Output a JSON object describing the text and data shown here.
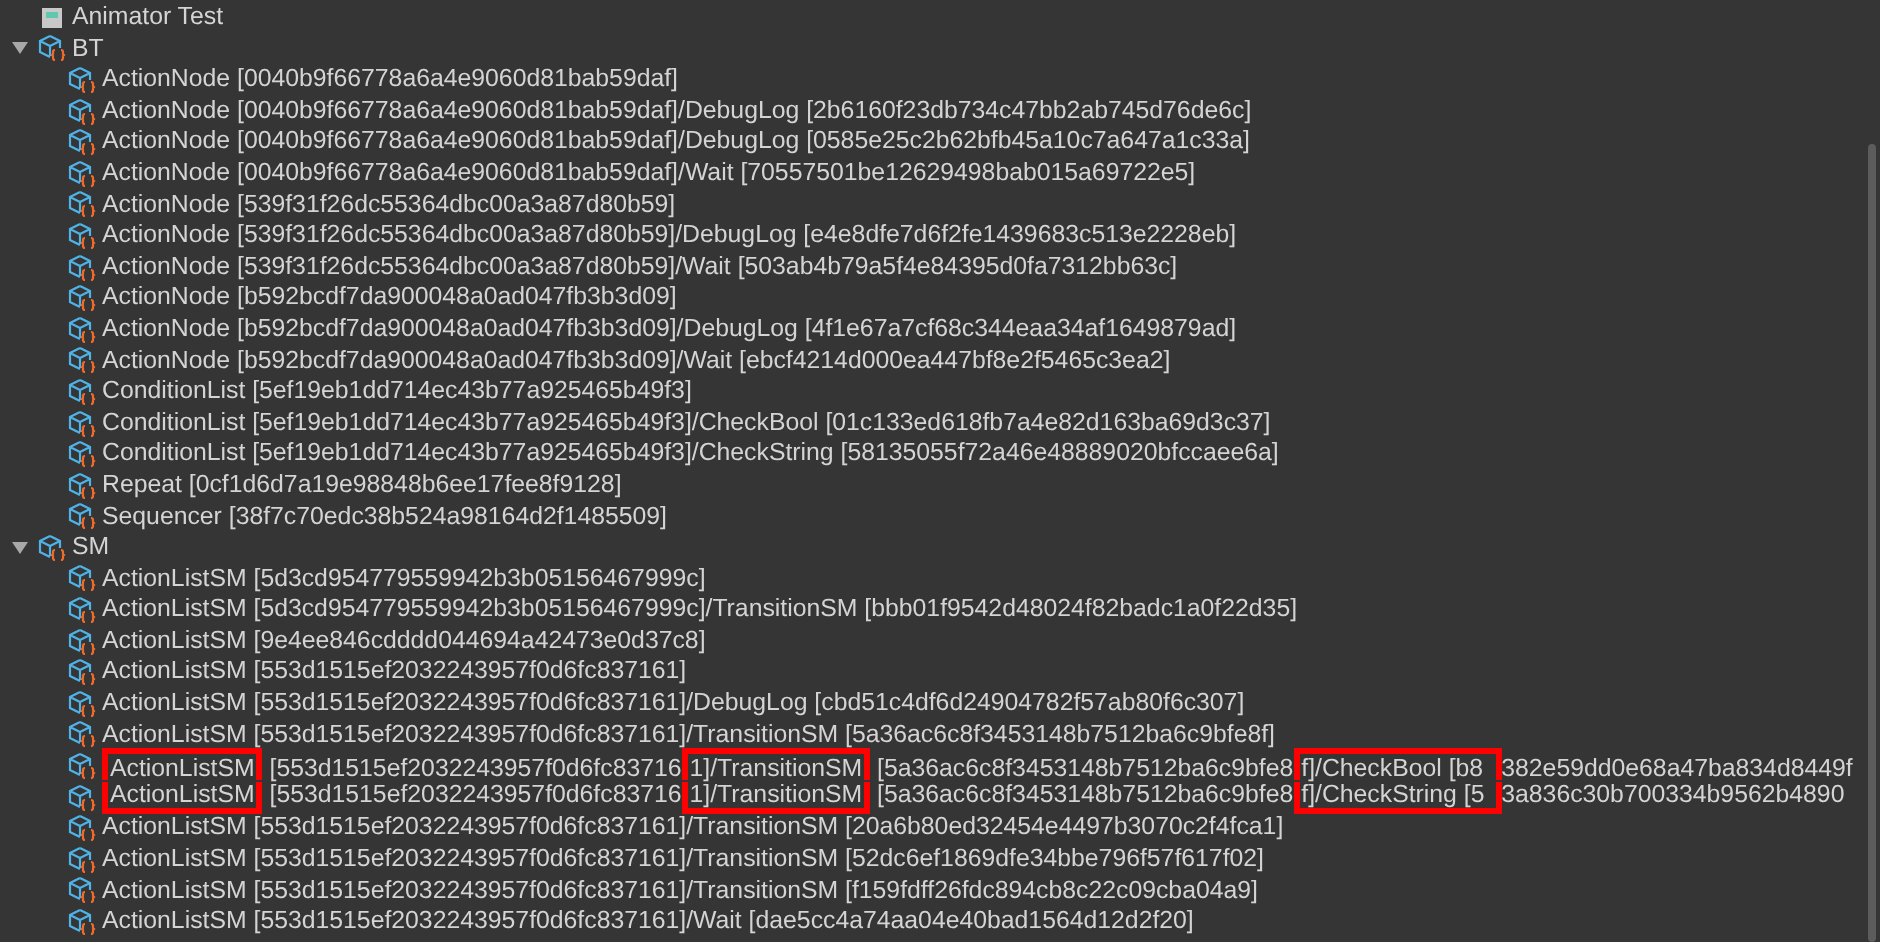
{
  "tree": [
    {
      "label": "Animator Test",
      "kind": "asset"
    },
    {
      "label": "BT",
      "kind": "group",
      "expanded": true,
      "children": [
        {
          "label": "ActionNode [0040b9f66778a6a4e9060d81bab59daf]",
          "kind": "node"
        },
        {
          "label": "ActionNode [0040b9f66778a6a4e9060d81bab59daf]/DebugLog [2b6160f23db734c47bb2ab745d76de6c]",
          "kind": "node"
        },
        {
          "label": "ActionNode [0040b9f66778a6a4e9060d81bab59daf]/DebugLog [0585e25c2b62bfb45a10c7a647a1c33a]",
          "kind": "node"
        },
        {
          "label": "ActionNode [0040b9f66778a6a4e9060d81bab59daf]/Wait [70557501be12629498bab015a69722e5]",
          "kind": "node"
        },
        {
          "label": "ActionNode [539f31f26dc55364dbc00a3a87d80b59]",
          "kind": "node"
        },
        {
          "label": "ActionNode [539f31f26dc55364dbc00a3a87d80b59]/DebugLog [e4e8dfe7d6f2fe1439683c513e2228eb]",
          "kind": "node"
        },
        {
          "label": "ActionNode [539f31f26dc55364dbc00a3a87d80b59]/Wait [503ab4b79a5f4e84395d0fa7312bb63c]",
          "kind": "node"
        },
        {
          "label": "ActionNode [b592bcdf7da900048a0ad047fb3b3d09]",
          "kind": "node"
        },
        {
          "label": "ActionNode [b592bcdf7da900048a0ad047fb3b3d09]/DebugLog [4f1e67a7cf68c344eaa34af1649879ad]",
          "kind": "node"
        },
        {
          "label": "ActionNode [b592bcdf7da900048a0ad047fb3b3d09]/Wait [ebcf4214d000ea447bf8e2f5465c3ea2]",
          "kind": "node"
        },
        {
          "label": "ConditionList [5ef19eb1dd714ec43b77a925465b49f3]",
          "kind": "node"
        },
        {
          "label": "ConditionList [5ef19eb1dd714ec43b77a925465b49f3]/CheckBool [01c133ed618fb7a4e82d163ba69d3c37]",
          "kind": "node"
        },
        {
          "label": "ConditionList [5ef19eb1dd714ec43b77a925465b49f3]/CheckString [58135055f72a46e48889020bfccaee6a]",
          "kind": "node"
        },
        {
          "label": "Repeat [0cf1d6d7a19e98848b6ee17fee8f9128]",
          "kind": "node"
        },
        {
          "label": "Sequencer [38f7c70edc38b524a98164d2f1485509]",
          "kind": "node"
        }
      ]
    },
    {
      "label": "SM",
      "kind": "group",
      "expanded": true,
      "children": [
        {
          "label": "ActionListSM [5d3cd954779559942b3b05156467999c]",
          "kind": "node"
        },
        {
          "label": "ActionListSM [5d3cd954779559942b3b05156467999c]/TransitionSM [bbb01f9542d48024f82badc1a0f22d35]",
          "kind": "node"
        },
        {
          "label": "ActionListSM [9e4ee846cdddd044694a42473e0d37c8]",
          "kind": "node"
        },
        {
          "label": "ActionListSM [553d1515ef2032243957f0d6fc837161]",
          "kind": "node"
        },
        {
          "label": "ActionListSM [553d1515ef2032243957f0d6fc837161]/DebugLog [cbd51c4df6d24904782f57ab80f6c307]",
          "kind": "node"
        },
        {
          "label": "ActionListSM [553d1515ef2032243957f0d6fc837161]/TransitionSM [5a36ac6c8f3453148b7512ba6c9bfe8f]",
          "kind": "node"
        },
        {
          "segments": [
            {
              "text": "ActionListSM",
              "kind": "boxed_top",
              "color": "#ff0000"
            },
            {
              "text": " [553d1515ef2032243957f0d6fc83716",
              "kind": "plain"
            },
            {
              "text": "1]/TransitionSM",
              "kind": "boxed_top",
              "color": "#ff0000"
            },
            {
              "text": " [5a36ac6c8f3453148b7512ba6c9bfe8",
              "kind": "plain"
            },
            {
              "text": "f]/CheckBool [b8",
              "kind": "boxed_top",
              "color": "#ff0000"
            },
            {
              "text": "382e59dd0e68a47ba834d8449f",
              "kind": "plain"
            }
          ],
          "kind": "node"
        },
        {
          "segments": [
            {
              "text": "ActionListSM",
              "kind": "boxed_bottom",
              "color": "#ff0000"
            },
            {
              "text": " [553d1515ef2032243957f0d6fc83716",
              "kind": "plain"
            },
            {
              "text": "1]/TransitionSM",
              "kind": "boxed_bottom",
              "color": "#ff0000"
            },
            {
              "text": " [5a36ac6c8f3453148b7512ba6c9bfe8",
              "kind": "plain"
            },
            {
              "text": "f]/CheckString [5",
              "kind": "boxed_bottom",
              "color": "#ff0000"
            },
            {
              "text": "3a836c30b700334b9562b4890",
              "kind": "plain"
            }
          ],
          "kind": "node"
        },
        {
          "label": "ActionListSM [553d1515ef2032243957f0d6fc837161]/TransitionSM [20a6b80ed32454e4497b3070c2f4fca1]",
          "kind": "node"
        },
        {
          "label": "ActionListSM [553d1515ef2032243957f0d6fc837161]/TransitionSM [52dc6ef1869dfe34bbe796f57f617f02]",
          "kind": "node"
        },
        {
          "label": "ActionListSM [553d1515ef2032243957f0d6fc837161]/TransitionSM [f159fdff26fdc894cb8c22c09cba04a9]",
          "kind": "node"
        },
        {
          "label": "ActionListSM [553d1515ef2032243957f0d6fc837161]/Wait [dae5cc4a74aa04e40bad1564d12d2f20]",
          "kind": "node"
        }
      ]
    }
  ]
}
